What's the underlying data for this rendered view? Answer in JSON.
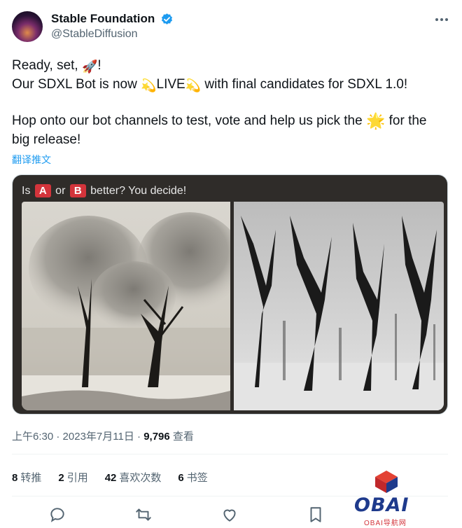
{
  "author": {
    "display_name": "Stable Foundation",
    "handle": "@StableDiffusion"
  },
  "tweet": {
    "line1_text": "Ready, set, ",
    "line1_end": "!",
    "line2_a": "Our SDXL Bot is now ",
    "line2_live": "LIVE",
    "line2_b": " with final candidates for SDXL 1.0!",
    "line3_a": "Hop onto our bot channels to test, vote and help us pick the ",
    "line3_b": " for the",
    "line4": "big release!",
    "emoji_rocket": "🚀",
    "emoji_dizzy": "💫",
    "emoji_star": "🌟"
  },
  "translate_label": "翻译推文",
  "media": {
    "caption_pre": "Is ",
    "badge_a": "A",
    "caption_or": " or ",
    "badge_b": "B",
    "caption_post": " better? You decide!"
  },
  "meta": {
    "time": "上午6:30",
    "sep1": " · ",
    "date": "2023年7月11日",
    "sep2": " · ",
    "views_count": "9,796",
    "views_label": " 查看"
  },
  "stats": [
    {
      "count": "8",
      "label": "转推"
    },
    {
      "count": "2",
      "label": "引用"
    },
    {
      "count": "42",
      "label": "喜欢次数"
    },
    {
      "count": "6",
      "label": "书签"
    }
  ],
  "icons": {
    "verified": "verified-badge-icon",
    "more": "more-options-icon",
    "reply": "reply-icon",
    "retweet": "retweet-icon",
    "like": "like-icon",
    "bookmark": "bookmark-icon"
  },
  "colors": {
    "accent": "#1d9bf0",
    "badge": "#d3343b",
    "secondary_text": "#536471"
  },
  "watermark": {
    "brand": "OBAI",
    "sub": "OBAI导航网"
  }
}
